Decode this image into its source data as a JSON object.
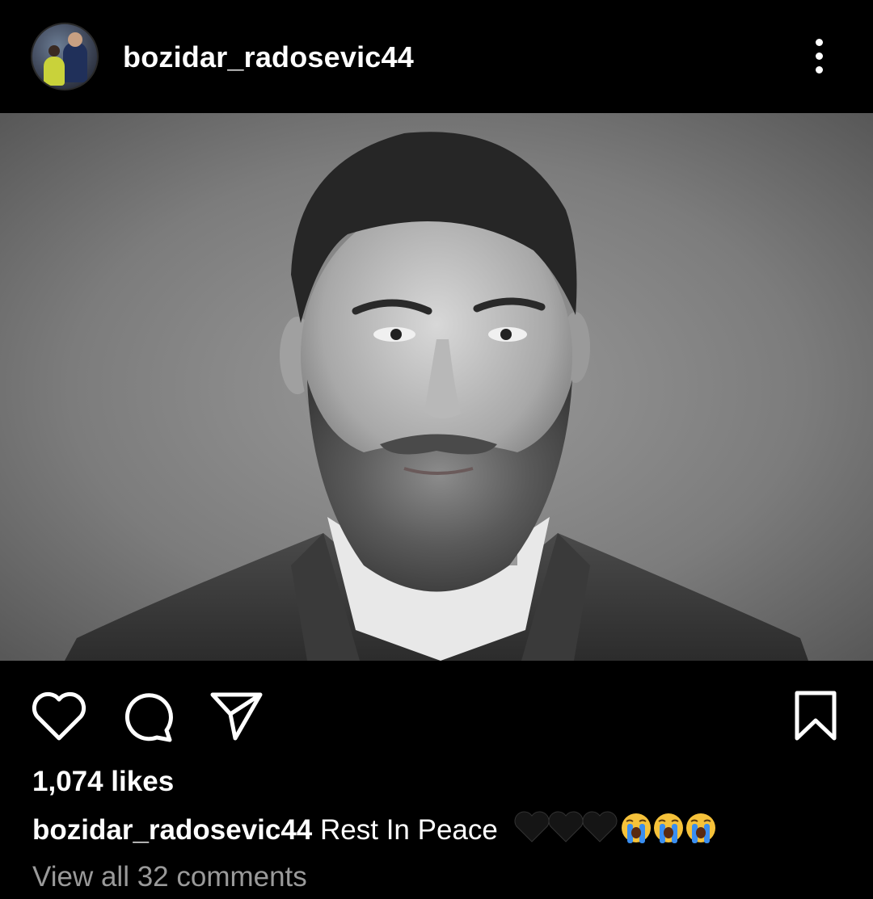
{
  "header": {
    "username": "bozidar_radosevic44",
    "avatar_icon": "profile-photo",
    "more_icon": "more-vertical-icon"
  },
  "post": {
    "image_icon": "post-photo"
  },
  "actions": {
    "like_icon": "heart-icon",
    "comment_icon": "comment-icon",
    "share_icon": "send-icon",
    "save_icon": "bookmark-icon"
  },
  "engagement": {
    "likes": "1,074 likes",
    "caption_user": "bozidar_radosevic44",
    "caption_text": "Rest In Peace",
    "caption_emojis": [
      "black-heart",
      "black-heart",
      "black-heart",
      "loudly-crying-face",
      "loudly-crying-face",
      "loudly-crying-face"
    ],
    "view_comments": "View all 32 comments"
  },
  "colors": {
    "background": "#000000",
    "text": "#ffffff",
    "muted_text": "#9a9a9a"
  }
}
